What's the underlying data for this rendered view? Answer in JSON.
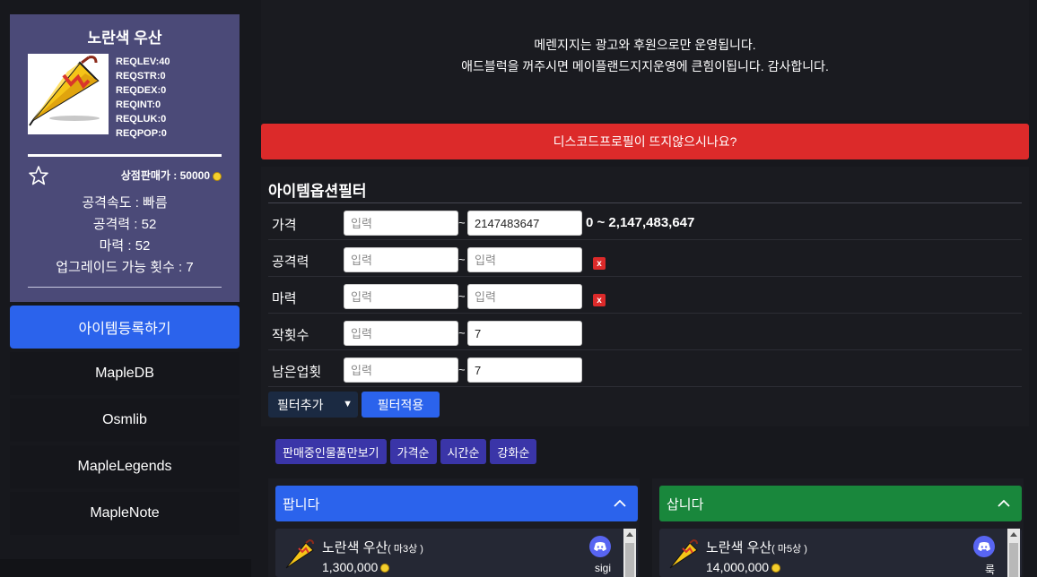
{
  "item": {
    "name": "노란색 우산",
    "reqs": [
      "REQLEV:40",
      "REQSTR:0",
      "REQDEX:0",
      "REQINT:0",
      "REQLUK:0",
      "REQPOP:0"
    ],
    "shop_price": "상점판매가 : 50000",
    "stats": [
      "공격속도 : 빠름",
      "공격력 : 52",
      "마력 : 52",
      "업그레이드 가능 횟수 : 7"
    ]
  },
  "nav": {
    "register": "아이템등록하기",
    "links": [
      "MapleDB",
      "Osmlib",
      "MapleLegends",
      "MapleNote"
    ]
  },
  "ad": {
    "line1": "메렌지지는 광고와 후원으로만 운영됩니다.",
    "line2": "애드블럭을 꺼주시면 메이플랜드지지운영에 큰힘이됩니다. 감사합니다."
  },
  "discord_banner": "디스코드프로필이 뜨지않으시나요?",
  "filter": {
    "title": "아이템옵션필터",
    "placeholder": "입력",
    "rows": [
      {
        "label": "가격",
        "min": "",
        "max": "2147483647",
        "note": "0 ~ 2,147,483,647",
        "removable": false
      },
      {
        "label": "공격력",
        "min": "",
        "max": "",
        "note": "",
        "removable": true
      },
      {
        "label": "마력",
        "min": "",
        "max": "",
        "note": "",
        "removable": true
      },
      {
        "label": "작횟수",
        "min": "",
        "max": "7",
        "note": "",
        "removable": false
      },
      {
        "label": "남은업횟",
        "min": "",
        "max": "7",
        "note": "",
        "removable": false
      }
    ],
    "remove_label": "x",
    "tilde": "~",
    "add_select": "필터추가",
    "apply": "필터적용"
  },
  "sort_buttons": [
    "판매중인물품만보기",
    "가격순",
    "시간순",
    "강화순"
  ],
  "sell": {
    "title": "팝니다",
    "listing": {
      "name": "노란색 우산",
      "mod": "( 마3상 )",
      "price": "1,300,000",
      "seller": "sigi"
    }
  },
  "buy": {
    "title": "삽니다",
    "listing": {
      "name": "노란색 우산",
      "mod": "( 마5상 )",
      "price": "14,000,000",
      "seller": "룩"
    }
  },
  "colors": {
    "accent_blue": "#2b63ec",
    "danger_red": "#dc2a2a",
    "buy_green": "#19873c",
    "card_purple": "#4b4a78",
    "sort_purple": "#3a35a8"
  }
}
